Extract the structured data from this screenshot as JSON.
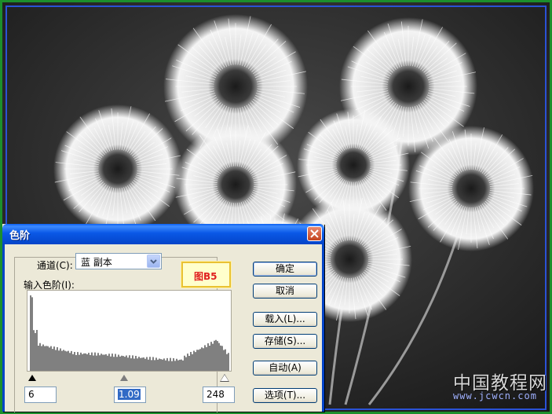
{
  "dialog": {
    "title": "色阶",
    "channel_label": "通道(C):",
    "channel_value": "蓝 副本",
    "input_levels_label": "输入色阶(I):",
    "input_black": "6",
    "input_gamma": "1.09",
    "input_white": "248",
    "buttons": {
      "ok": "确定",
      "cancel": "取消",
      "load": "载入(L)...",
      "save": "存储(S)...",
      "auto": "自动(A)",
      "options": "选项(T)..."
    }
  },
  "figure_label": "图B5",
  "watermark": {
    "chinese": "中国教程网",
    "url": "www.jcwcn.com"
  },
  "icons": {
    "close": "close-icon",
    "dropdown": "chevron-down-icon"
  },
  "colors": {
    "titlebar": "#0a58e6",
    "dialog_bg": "#ece9d8",
    "frame_green": "#1c8f2c",
    "frame_blue": "#2a52d6",
    "figure_label_text": "#e02020"
  }
}
